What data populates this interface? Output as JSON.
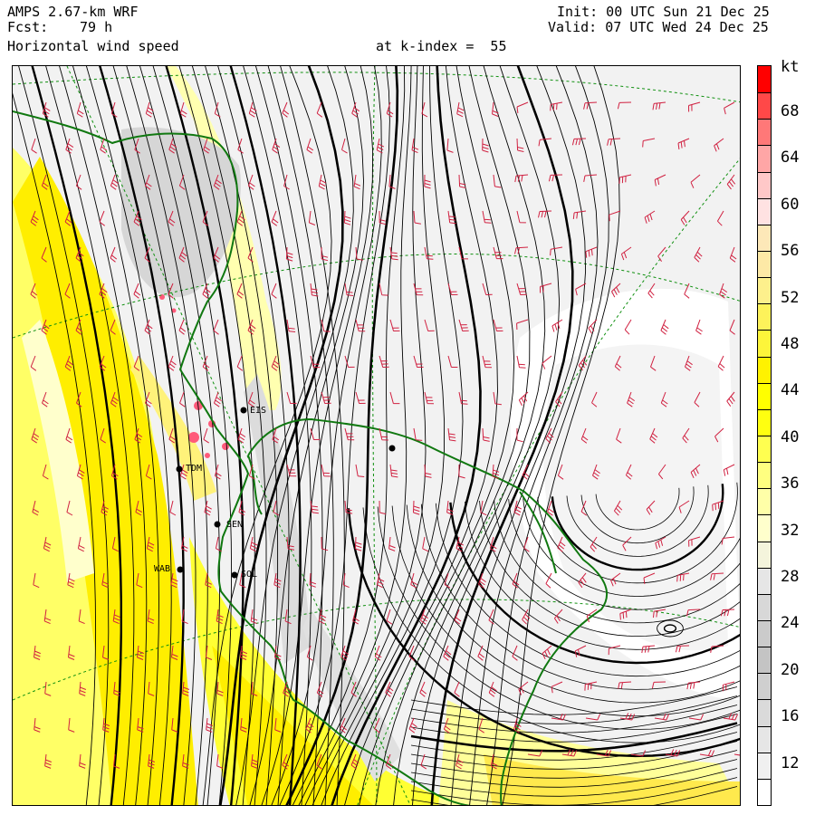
{
  "header": {
    "model": "AMPS 2.67-km WRF",
    "forecast_label": "Fcst:",
    "forecast_hours": "79 h",
    "field_name": "Horizontal wind speed",
    "level": "at k-index =  55",
    "init": "Init: 00 UTC Sun 21 Dec 25",
    "valid": "Valid: 07 UTC Wed 24 Dec 25"
  },
  "colorbar": {
    "unit": "kt",
    "labels": [
      "68",
      "64",
      "60",
      "56",
      "52",
      "48",
      "44",
      "40",
      "36",
      "32",
      "28",
      "24",
      "20",
      "16",
      "12"
    ],
    "colors": [
      "#ff0000",
      "#ff4848",
      "#ff7878",
      "#ffa6a6",
      "#ffc8c8",
      "#ffe2e2",
      "#fde8b8",
      "#fde9a6",
      "#fdf08c",
      "#fdf25a",
      "#fdf53a",
      "#fff200",
      "#ffff00",
      "#ffff10",
      "#ffff50",
      "#ffff80",
      "#ffffa8",
      "#ffffcc",
      "#f4f4dc",
      "#e6e6e6",
      "#d8d8d8",
      "#cbcbcb",
      "#c4c4c4",
      "#cfcfcf",
      "#dadada",
      "#e6e6e6",
      "#f0f0f0",
      "#ffffff"
    ]
  },
  "stations": [
    {
      "code": "EIS"
    },
    {
      "code": "TDM"
    },
    {
      "code": "SEN"
    },
    {
      "code": "WAB"
    },
    {
      "code": "SOL"
    },
    {
      "code": ""
    }
  ],
  "map_colors": {
    "coast": "#107810",
    "isotach": "#000000",
    "barb": "#d02040",
    "graticule": "#109010"
  }
}
